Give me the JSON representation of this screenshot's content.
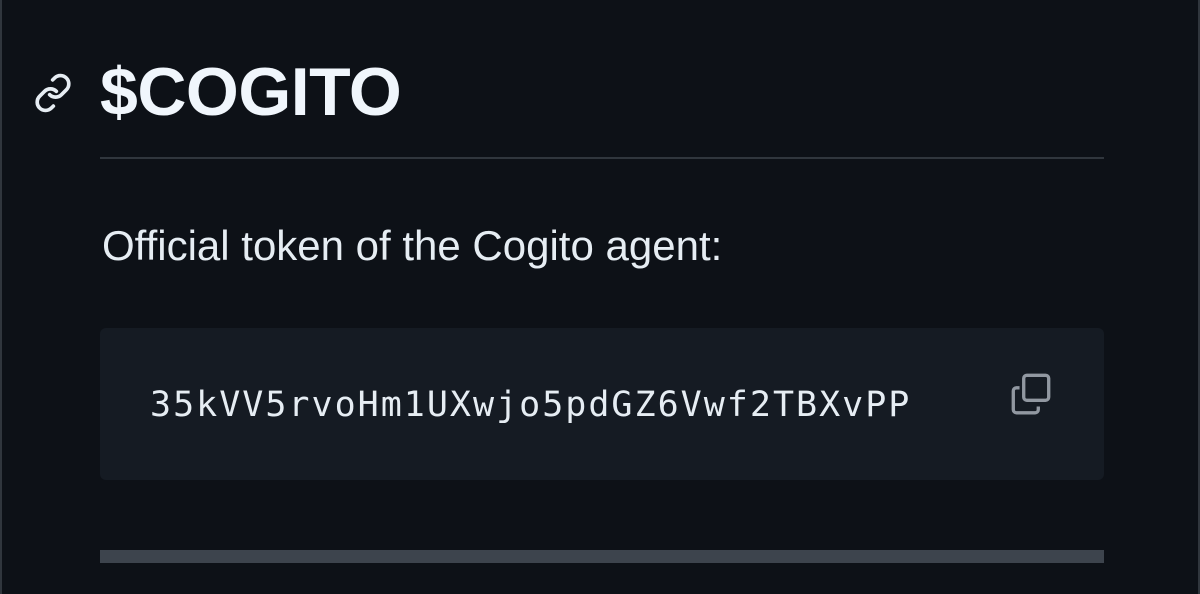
{
  "heading": {
    "anchor_icon": "link-icon",
    "title": "$COGITO"
  },
  "description": "Official token of the Cogito agent:",
  "code_block": {
    "address": "35kVV5rvoHm1UXwjo5pdGZ6Vwf2TBXvPP",
    "copy_icon": "copy-icon"
  },
  "colors": {
    "background": "#0d1117",
    "code_background": "#151b23",
    "divider": "#30363d",
    "text": "#e6edf3"
  }
}
